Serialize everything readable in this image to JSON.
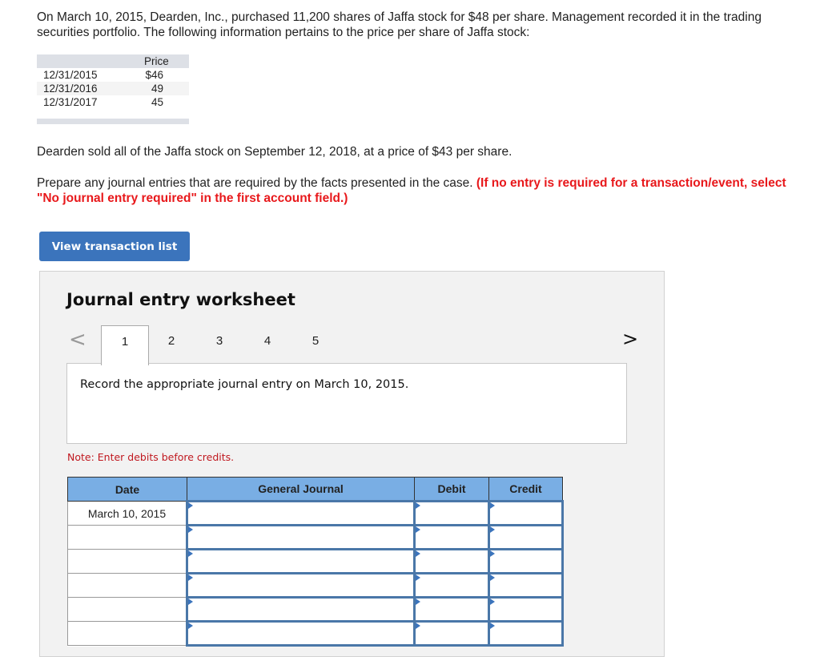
{
  "problem": {
    "intro": "On March 10, 2015, Dearden, Inc., purchased 11,200 shares of Jaffa stock for $48 per share. Management recorded it in the trading securities portfolio. The following information pertains to the price per share of Jaffa stock:",
    "price_table": {
      "header": "Price",
      "rows": [
        {
          "date": "12/31/2015",
          "price": "$46"
        },
        {
          "date": "12/31/2016",
          "price": "49"
        },
        {
          "date": "12/31/2017",
          "price": "45"
        }
      ]
    },
    "sold": "Dearden sold all of the Jaffa stock on September 12, 2018, at a price of $43 per share.",
    "prepare_text": "Prepare any journal entries that are required by the facts presented in the case. ",
    "prepare_red": "(If no entry is required for a transaction/event, select \"No journal entry required\" in the first account field.)"
  },
  "buttons": {
    "view_transaction_list": "View transaction list"
  },
  "worksheet": {
    "title": "Journal entry worksheet",
    "nav_prev": "<",
    "nav_next": ">",
    "tabs": [
      "1",
      "2",
      "3",
      "4",
      "5"
    ],
    "active_tab": "1",
    "instruction": "Record the appropriate journal entry on March 10, 2015.",
    "note": "Note: Enter debits before credits.",
    "table": {
      "headers": [
        "Date",
        "General Journal",
        "Debit",
        "Credit"
      ],
      "rows": [
        {
          "date": "March 10, 2015",
          "account": "",
          "debit": "",
          "credit": ""
        },
        {
          "date": "",
          "account": "",
          "debit": "",
          "credit": ""
        },
        {
          "date": "",
          "account": "",
          "debit": "",
          "credit": ""
        },
        {
          "date": "",
          "account": "",
          "debit": "",
          "credit": ""
        },
        {
          "date": "",
          "account": "",
          "debit": "",
          "credit": ""
        },
        {
          "date": "",
          "account": "",
          "debit": "",
          "credit": ""
        }
      ]
    }
  },
  "colors": {
    "button_blue": "#3b74bc",
    "header_blue": "#79aee4",
    "red_text": "#e8181b",
    "note_red": "#c0181f"
  }
}
